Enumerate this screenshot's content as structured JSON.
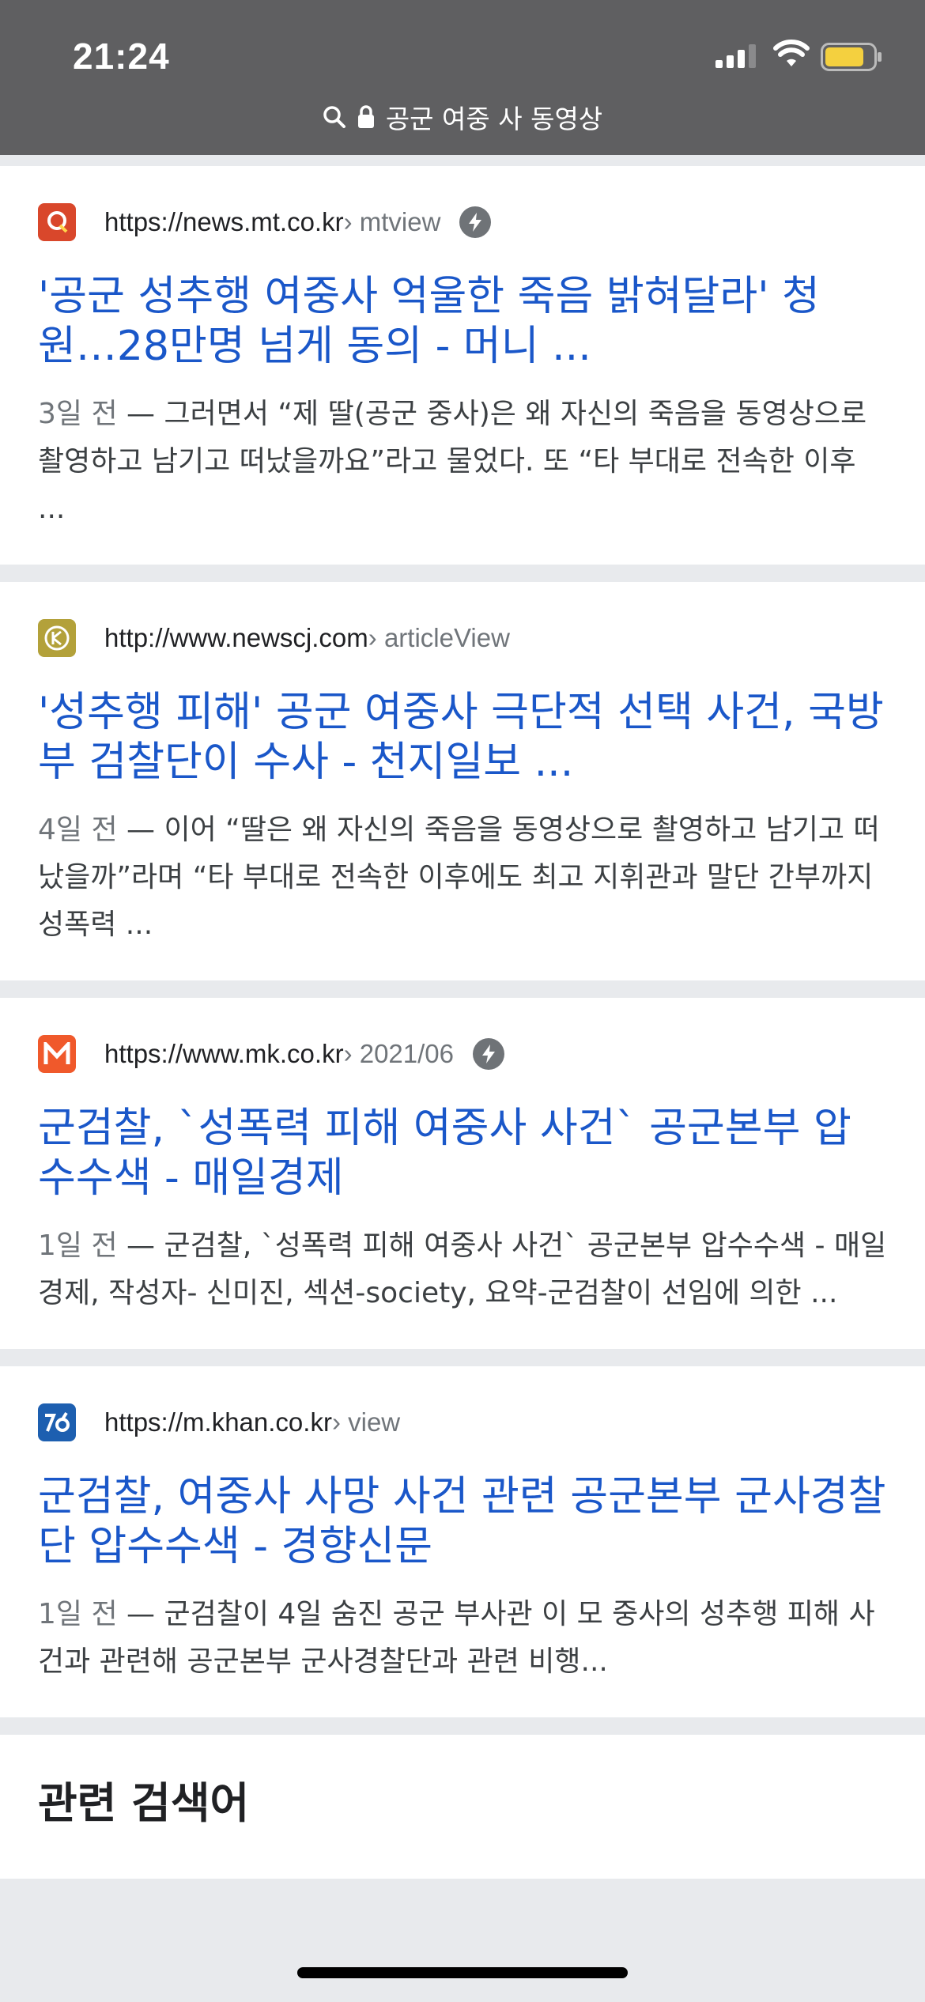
{
  "status": {
    "time": "21:24"
  },
  "url_bar": {
    "query": "공군 여중 사 동영상"
  },
  "results": [
    {
      "domain": "https://news.mt.co.kr",
      "path": " › mtview",
      "amp": true,
      "favicon": "mt-favicon",
      "title": "'공군 성추행 여중사 억울한 죽음 밝혀달라' 청원…28만명 넘게 동의 - 머니 ...",
      "date": "3일 전",
      "snippet": " — 그러면서 “제 딸(공군 중사)은 왜 자신의 죽음을 동영상으로 촬영하고 남기고 떠났을까요”라고 물었다. 또 “타 부대로 전속한 이후 ..."
    },
    {
      "domain": "http://www.newscj.com",
      "path": " › articleView",
      "amp": false,
      "favicon": "newscj-favicon",
      "title": "'성추행 피해' 공군 여중사 극단적 선택 사건, 국방부 검찰단이 수사 - 천지일보 ...",
      "date": "4일 전",
      "snippet": " — 이어 “딸은 왜 자신의 죽음을 동영상으로 촬영하고 남기고 떠났을까”라며 “타 부대로 전속한 이후에도 최고 지휘관과 말단 간부까지 성폭력 ..."
    },
    {
      "domain": "https://www.mk.co.kr",
      "path": " › 2021/06",
      "amp": true,
      "favicon": "mk-favicon",
      "title": "군검찰, `성폭력 피해 여중사 사건` 공군본부 압수수색 - 매일경제",
      "date": "1일 전",
      "snippet": " — 군검찰, `성폭력 피해 여중사 사건` 공군본부 압수수색 - 매일경제, 작성자- 신미진, 섹션-society, 요약-군검찰이 선임에 의한 ..."
    },
    {
      "domain": "https://m.khan.co.kr",
      "path": " › view",
      "amp": false,
      "favicon": "khan-favicon",
      "title": "군검찰, 여중사 사망 사건 관련 공군본부 군사경찰단 압수수색 - 경향신문",
      "date": "1일 전",
      "snippet": " — 군검찰이 4일 숨진 공군 부사관 이 모 중사의 성추행 피해 사건과 관련해 공군본부 군사경찰단과 관련 비행..."
    }
  ],
  "related": {
    "heading": "관련 검색어"
  },
  "colors": {
    "link": "#1a57c9",
    "status_bg": "#5f5f61",
    "battery": "#f4d03f"
  }
}
